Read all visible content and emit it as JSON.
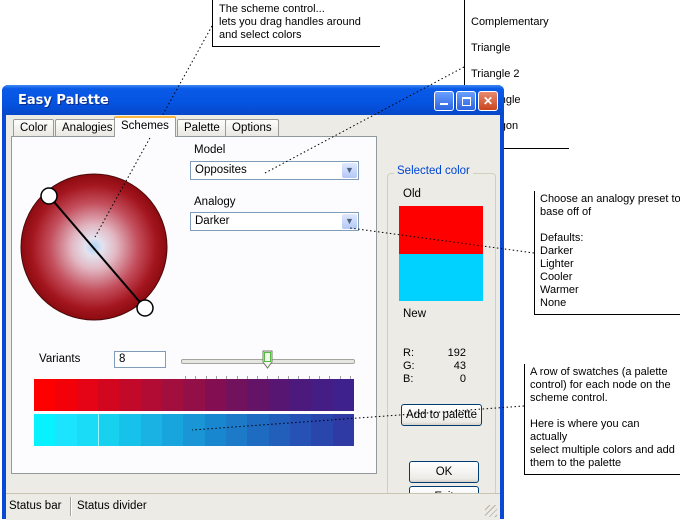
{
  "annotations": {
    "scheme_control": "The scheme control...\nlets you drag handles around\nand select colors",
    "models_list": [
      "Complementary",
      "Triangle",
      "Triangle 2",
      "Rectangle",
      "Pentagon"
    ],
    "analogy_note": "Choose an analogy preset to\nbase off of\n\nDefaults:\nDarker\nLighter\nCooler\nWarmer\nNone",
    "swatch_note": "A row of swatches (a palette\ncontrol) for each node on the\nscheme control.\n\nHere is where you can actually\nselect multiple colors and add\nthem to the palette"
  },
  "window": {
    "title": "Easy Palette",
    "buttons": {
      "minimize": "minimize-icon",
      "maximize": "maximize-icon",
      "close": "close-icon"
    }
  },
  "tabs": [
    "Color",
    "Analogies",
    "Schemes",
    "Palette",
    "Options"
  ],
  "active_tab": "Schemes",
  "scheme": {
    "model_label": "Model",
    "model_value": "Opposites",
    "analogy_label": "Analogy",
    "analogy_value": "Darker",
    "variants_label": "Variants",
    "variants_value": "8",
    "slider_fraction": 0.5,
    "swatch_row_1": [
      "#ff0000",
      "#f30109",
      "#e40415",
      "#d3061f",
      "#c2092a",
      "#b20c34",
      "#a20f3e",
      "#930f48",
      "#830f52",
      "#72125c",
      "#631467",
      "#561672",
      "#4b1a7c",
      "#441d85",
      "#3f218e"
    ],
    "swatch_row_2": [
      "#08f1ff",
      "#1ce4ff",
      "#1bdcf6",
      "#17d1ef",
      "#16c2e9",
      "#1ab2e3",
      "#18a4dc",
      "#1a95d6",
      "#1987cf",
      "#1c7ac8",
      "#1e6cc1",
      "#225fbb",
      "#2552b4",
      "#2946ad",
      "#2f3aa5"
    ],
    "swatch_row_2_selected": 3
  },
  "selected_color": {
    "title": "Selected color",
    "old_label": "Old",
    "new_label": "New",
    "old_color": "#ff0000",
    "new_color": "#00d2ff",
    "r_label": "R:",
    "g_label": "G:",
    "b_label": "B:",
    "r": "192",
    "g": "43",
    "b": "0",
    "add_button": "Add to palette"
  },
  "dialog_buttons": {
    "ok": "OK",
    "exit": "Exit"
  },
  "statusbar": {
    "cell1": "Status bar",
    "cell2": "Status divider"
  },
  "colors": {
    "titlebar": "#0553e1",
    "accent_tab": "#f8b640",
    "group_title": "#0046d5"
  }
}
